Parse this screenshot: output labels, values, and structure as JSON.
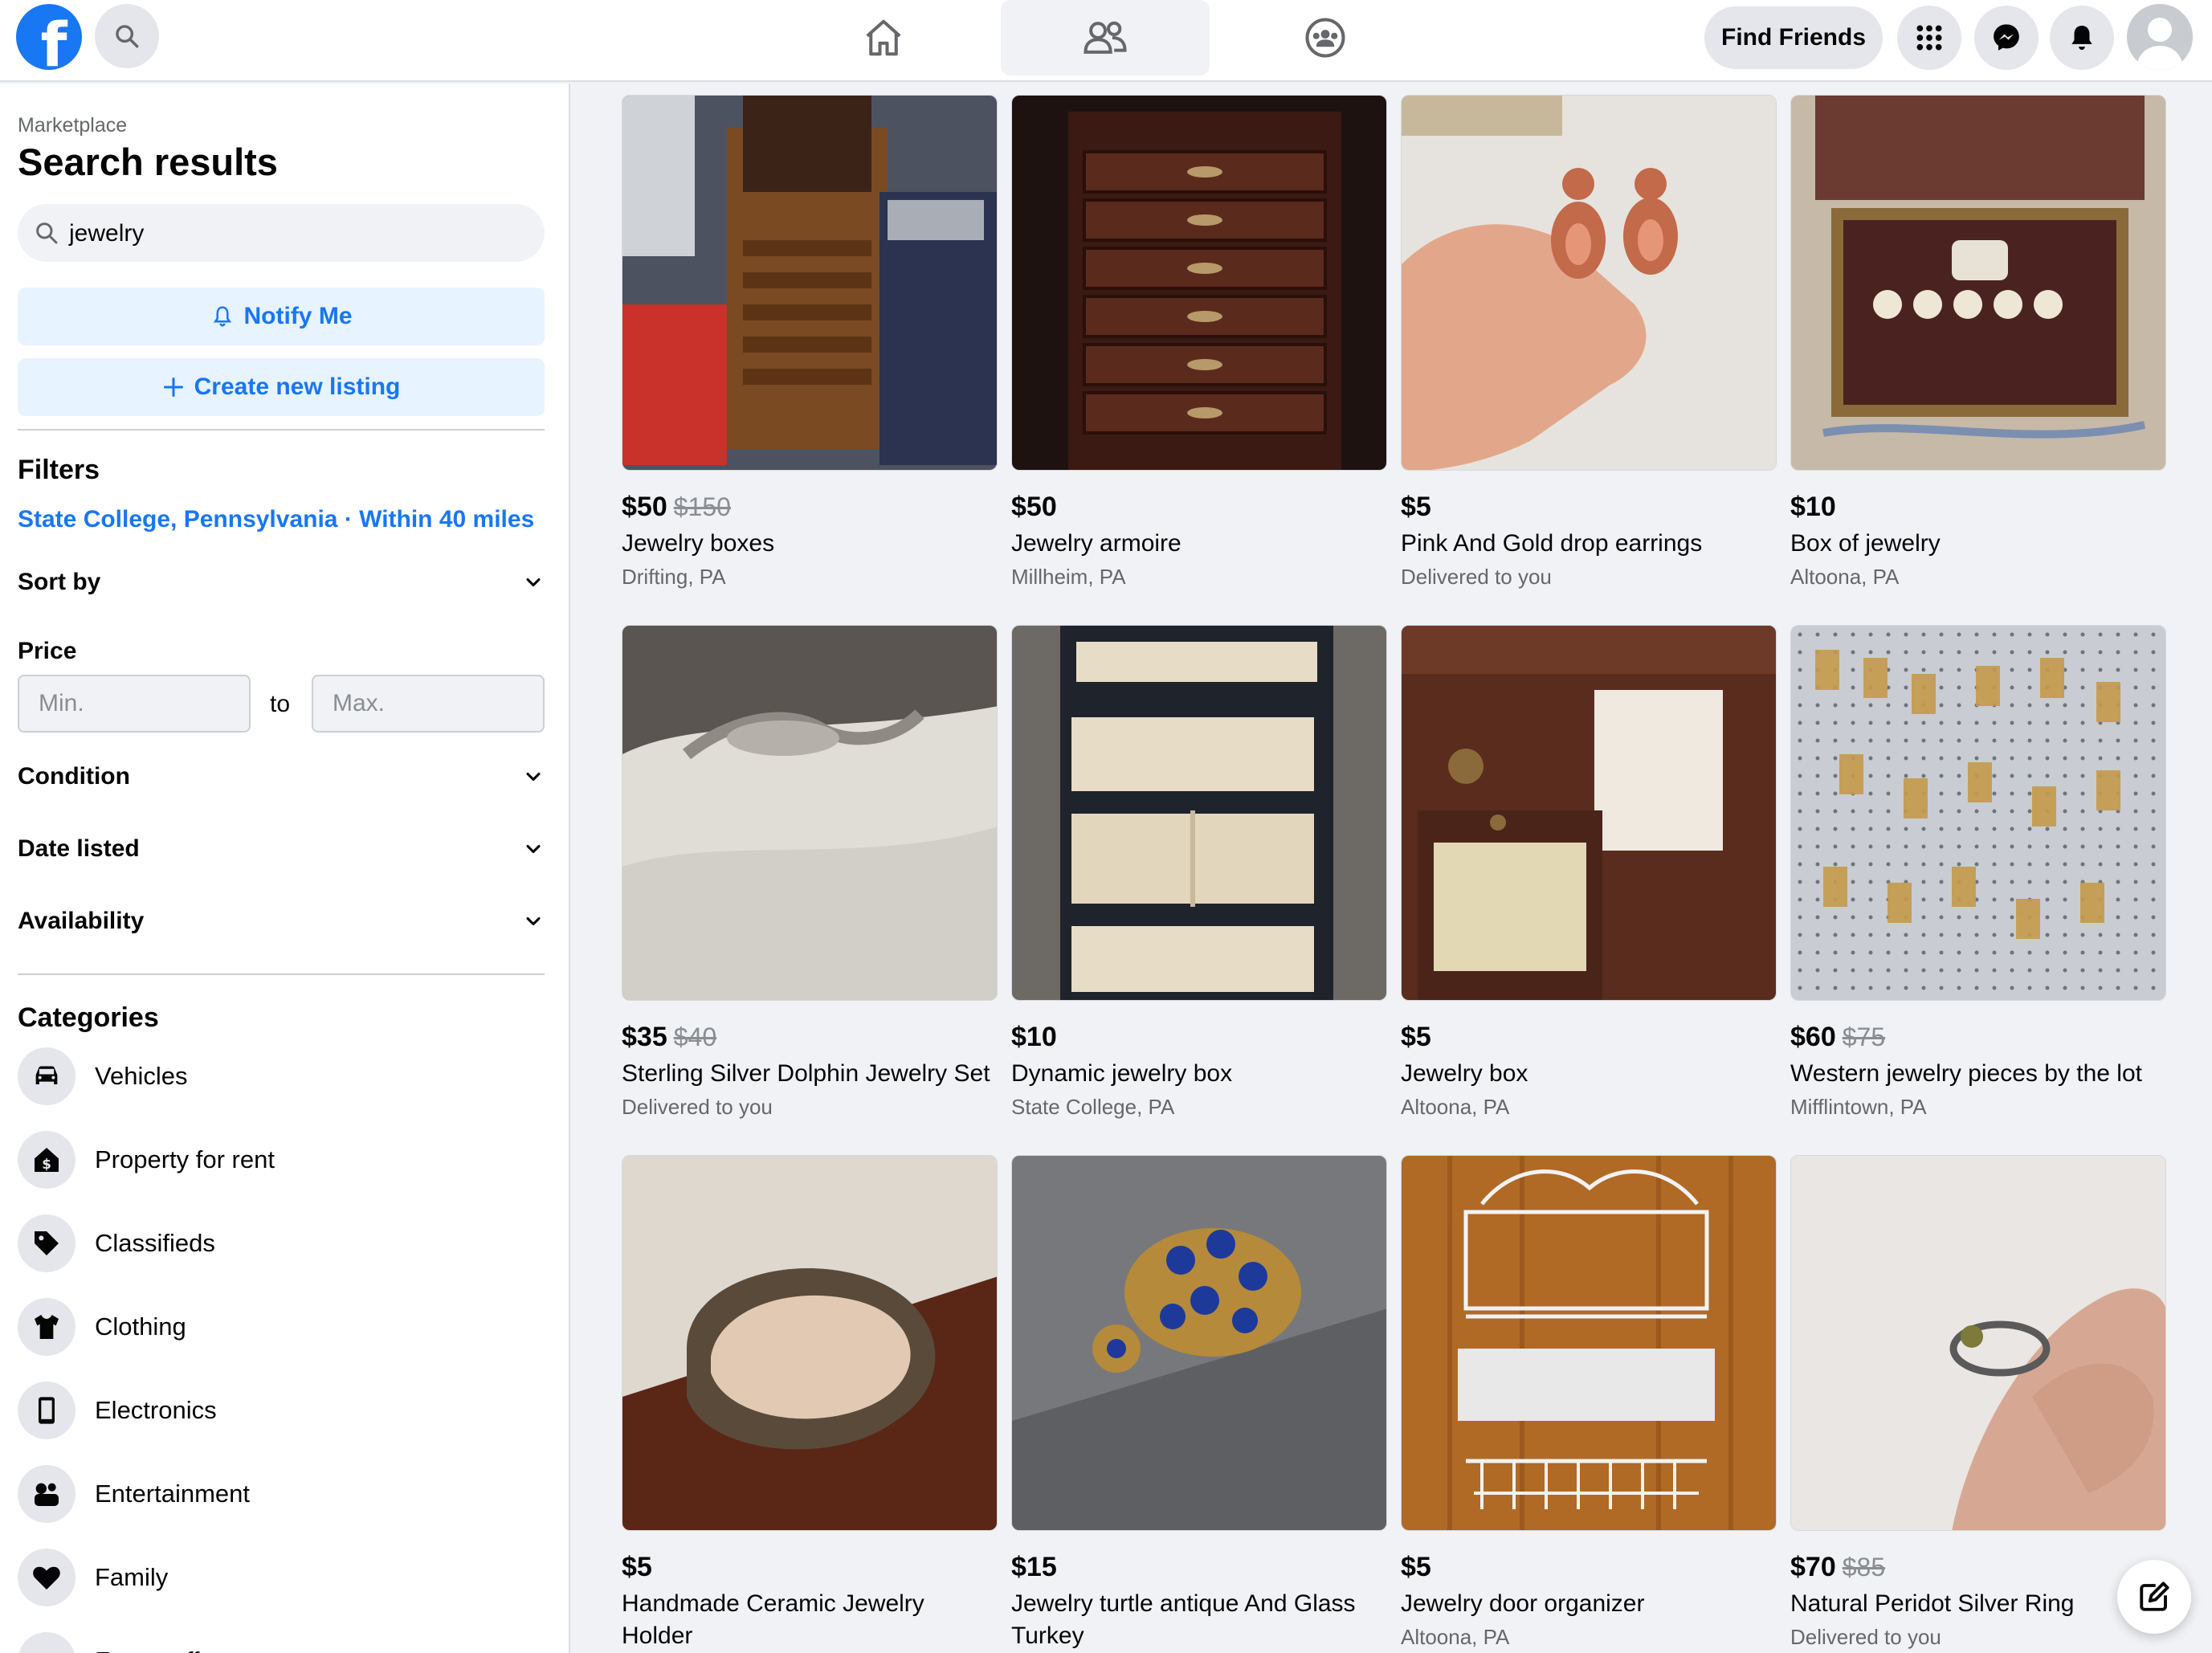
{
  "header": {
    "logo_letter": "f",
    "find_friends_label": "Find Friends",
    "nav_tabs": [
      {
        "name": "home",
        "icon": "home-icon",
        "active": false
      },
      {
        "name": "friends",
        "icon": "friends-icon",
        "active": true
      },
      {
        "name": "groups",
        "icon": "groups-icon",
        "active": false
      }
    ],
    "right_icons": [
      "menu-grid-icon",
      "messenger-icon",
      "notifications-bell-icon",
      "profile-avatar"
    ]
  },
  "sidebar": {
    "breadcrumb": "Marketplace",
    "title": "Search results",
    "search": {
      "value": "jewelry"
    },
    "notify_label": "Notify Me",
    "create_label": "Create new listing",
    "filters_title": "Filters",
    "location": "State College, Pennsylvania · Within 40 miles",
    "sort_label": "Sort by",
    "price_label": "Price",
    "price_min_placeholder": "Min.",
    "price_to": "to",
    "price_max_placeholder": "Max.",
    "condition_label": "Condition",
    "date_label": "Date listed",
    "availability_label": "Availability",
    "categories_title": "Categories",
    "categories": [
      {
        "label": "Vehicles",
        "icon": "car-icon"
      },
      {
        "label": "Property for rent",
        "icon": "house-dollar-icon"
      },
      {
        "label": "Classifieds",
        "icon": "tag-icon"
      },
      {
        "label": "Clothing",
        "icon": "shirt-icon"
      },
      {
        "label": "Electronics",
        "icon": "phone-icon"
      },
      {
        "label": "Entertainment",
        "icon": "people-icon"
      },
      {
        "label": "Family",
        "icon": "heart-icon"
      },
      {
        "label": "Free stuff",
        "icon": "gift-icon"
      }
    ]
  },
  "listings": [
    {
      "price": "$50",
      "original": "$150",
      "title": "Jewelry boxes",
      "location": "Drifting, PA",
      "colors": [
        "#7a4a22",
        "#3b3f52"
      ]
    },
    {
      "price": "$50",
      "original": "",
      "title": "Jewelry armoire",
      "location": "Millheim, PA",
      "colors": [
        "#3a1a12",
        "#5a2a1c"
      ]
    },
    {
      "price": "$5",
      "original": "",
      "title": "Pink And Gold drop earrings",
      "location": "Delivered to you",
      "colors": [
        "#e8e4e0",
        "#d98a6c"
      ]
    },
    {
      "price": "$10",
      "original": "",
      "title": "Box of jewelry",
      "location": "Altoona, PA",
      "colors": [
        "#6b3a30",
        "#c7b9a8"
      ]
    },
    {
      "price": "$35",
      "original": "$40",
      "title": "Sterling Silver Dolphin Jewelry Set",
      "location": "Delivered to you",
      "colors": [
        "#dcd8d2",
        "#a7a19a"
      ]
    },
    {
      "price": "$10",
      "original": "",
      "title": "Dynamic jewelry box",
      "location": "State College, PA",
      "colors": [
        "#2b2f38",
        "#e7dcc5"
      ]
    },
    {
      "price": "$5",
      "original": "",
      "title": "Jewelry box",
      "location": "Altoona, PA",
      "colors": [
        "#6e3a28",
        "#e2d8b4"
      ]
    },
    {
      "price": "$60",
      "original": "$75",
      "title": "Western jewelry pieces by the lot",
      "location": "Mifflintown, PA",
      "colors": [
        "#c9ccd3",
        "#c59b4a"
      ]
    },
    {
      "price": "$5",
      "original": "",
      "title": "Handmade Ceramic Jewelry Holder",
      "location": "",
      "colors": [
        "#5a2616",
        "#e2c9b4"
      ]
    },
    {
      "price": "$15",
      "original": "",
      "title": "Jewelry turtle antique And Glass Turkey",
      "location": "",
      "colors": [
        "#77787b",
        "#1d3a9a"
      ]
    },
    {
      "price": "$5",
      "original": "",
      "title": "Jewelry door organizer",
      "location": "Altoona, PA",
      "colors": [
        "#b06a25",
        "#f2f2f2"
      ]
    },
    {
      "price": "$70",
      "original": "$85",
      "title": "Natural Peridot Silver Ring",
      "location": "Delivered to you",
      "colors": [
        "#e9e6e3",
        "#d6a893"
      ]
    }
  ],
  "accent_color": "#1877f2"
}
